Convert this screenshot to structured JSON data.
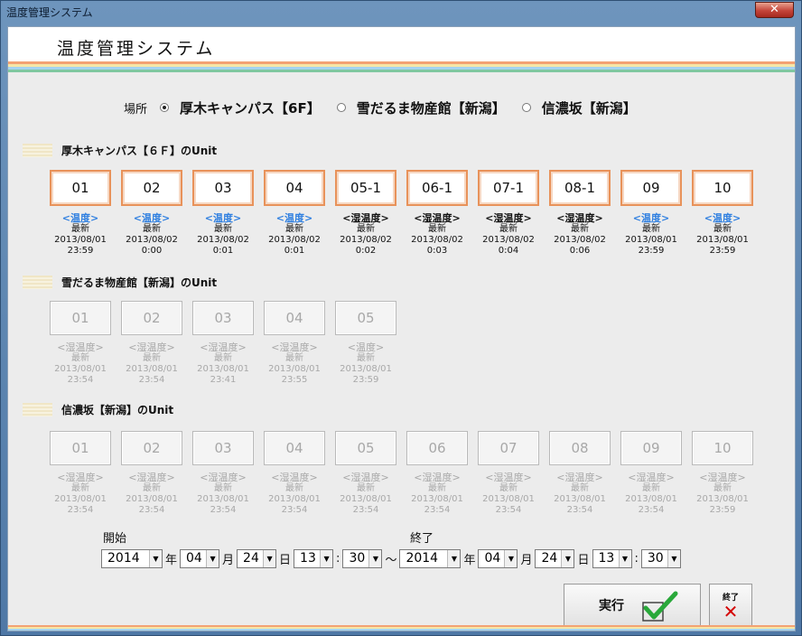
{
  "window": {
    "title": "温度管理システム",
    "close": "✕"
  },
  "header": {
    "title": "温度管理システム"
  },
  "colors": {
    "stripes": [
      "#f3a273",
      "#f6e7a8",
      "#a5d3f0",
      "#7fc7a0"
    ],
    "unit_border": "#e8925a",
    "temp_blue": "#2f7fe0"
  },
  "location": {
    "label": "場所",
    "options": [
      {
        "label": "厚木キャンパス【6F】",
        "selected": true
      },
      {
        "label": "雪だるま物産館【新潟】",
        "selected": false
      },
      {
        "label": "信濃坂【新潟】",
        "selected": false
      }
    ]
  },
  "sections": [
    {
      "title": "厚木キャンパス【６Ｆ】のUnit",
      "enabled": true,
      "units": [
        {
          "id": "01",
          "type": "<温度>",
          "blue": true,
          "status": "最新",
          "date": "2013/08/01",
          "time": "23:59"
        },
        {
          "id": "02",
          "type": "<温度>",
          "blue": true,
          "status": "最新",
          "date": "2013/08/02",
          "time": "0:00"
        },
        {
          "id": "03",
          "type": "<温度>",
          "blue": true,
          "status": "最新",
          "date": "2013/08/02",
          "time": "0:01"
        },
        {
          "id": "04",
          "type": "<温度>",
          "blue": true,
          "status": "最新",
          "date": "2013/08/02",
          "time": "0:01"
        },
        {
          "id": "05-1",
          "type": "<湿温度>",
          "blue": false,
          "status": "最新",
          "date": "2013/08/02",
          "time": "0:02"
        },
        {
          "id": "06-1",
          "type": "<湿温度>",
          "blue": false,
          "status": "最新",
          "date": "2013/08/02",
          "time": "0:03"
        },
        {
          "id": "07-1",
          "type": "<湿温度>",
          "blue": false,
          "status": "最新",
          "date": "2013/08/02",
          "time": "0:04"
        },
        {
          "id": "08-1",
          "type": "<湿温度>",
          "blue": false,
          "status": "最新",
          "date": "2013/08/02",
          "time": "0:06"
        },
        {
          "id": "09",
          "type": "<温度>",
          "blue": true,
          "status": "最新",
          "date": "2013/08/01",
          "time": "23:59"
        },
        {
          "id": "10",
          "type": "<温度>",
          "blue": true,
          "status": "最新",
          "date": "2013/08/01",
          "time": "23:59"
        }
      ]
    },
    {
      "title": "雪だるま物産館【新潟】のUnit",
      "enabled": false,
      "units": [
        {
          "id": "01",
          "type": "<湿温度>",
          "status": "最新",
          "date": "2013/08/01",
          "time": "23:54"
        },
        {
          "id": "02",
          "type": "<湿温度>",
          "status": "最新",
          "date": "2013/08/01",
          "time": "23:54"
        },
        {
          "id": "03",
          "type": "<湿温度>",
          "status": "最新",
          "date": "2013/08/01",
          "time": "23:41"
        },
        {
          "id": "04",
          "type": "<湿温度>",
          "status": "最新",
          "date": "2013/08/01",
          "time": "23:55"
        },
        {
          "id": "05",
          "type": "<温度>",
          "status": "最新",
          "date": "2013/08/01",
          "time": "23:59"
        }
      ]
    },
    {
      "title": "信濃坂【新潟】のUnit",
      "enabled": false,
      "units": [
        {
          "id": "01",
          "type": "<湿温度>",
          "status": "最新",
          "date": "2013/08/01",
          "time": "23:54"
        },
        {
          "id": "02",
          "type": "<湿温度>",
          "status": "最新",
          "date": "2013/08/01",
          "time": "23:54"
        },
        {
          "id": "03",
          "type": "<湿温度>",
          "status": "最新",
          "date": "2013/08/01",
          "time": "23:54"
        },
        {
          "id": "04",
          "type": "<湿温度>",
          "status": "最新",
          "date": "2013/08/01",
          "time": "23:54"
        },
        {
          "id": "05",
          "type": "<湿温度>",
          "status": "最新",
          "date": "2013/08/01",
          "time": "23:54"
        },
        {
          "id": "06",
          "type": "<湿温度>",
          "status": "最新",
          "date": "2013/08/01",
          "time": "23:54"
        },
        {
          "id": "07",
          "type": "<湿温度>",
          "status": "最新",
          "date": "2013/08/01",
          "time": "23:54"
        },
        {
          "id": "08",
          "type": "<湿温度>",
          "status": "最新",
          "date": "2013/08/01",
          "time": "23:54"
        },
        {
          "id": "09",
          "type": "<湿温度>",
          "status": "最新",
          "date": "2013/08/01",
          "time": "23:54"
        },
        {
          "id": "10",
          "type": "<湿温度>",
          "status": "最新",
          "date": "2013/08/01",
          "time": "23:59"
        }
      ]
    }
  ],
  "period": {
    "start_label": "開始",
    "end_label": "終了",
    "start": {
      "year": "2014",
      "month": "04",
      "day": "24",
      "hour": "13",
      "minute": "30"
    },
    "end": {
      "year": "2014",
      "month": "04",
      "day": "24",
      "hour": "13",
      "minute": "30"
    },
    "units": {
      "year": "年",
      "month": "月",
      "day": "日",
      "colon": ":",
      "tilde": "～"
    }
  },
  "actions": {
    "run_label": "実行",
    "exit_label": "終了",
    "exit_icon": "✕"
  }
}
